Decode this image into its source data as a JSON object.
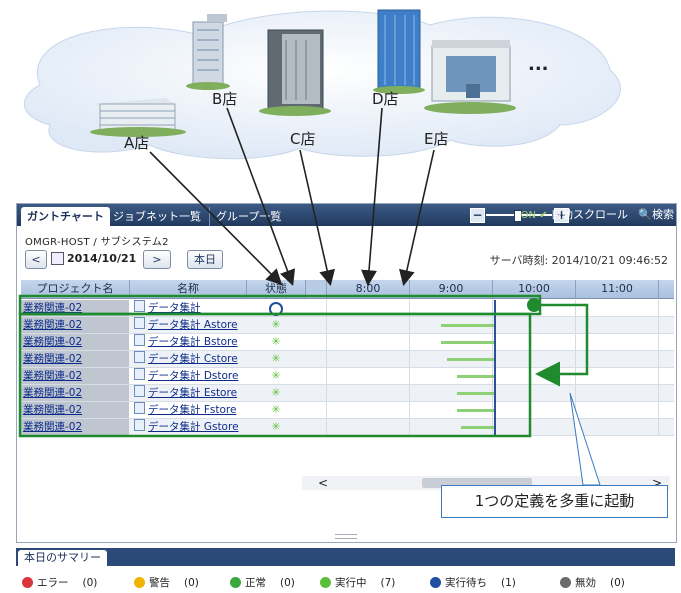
{
  "hero": {
    "stores": [
      "A店",
      "B店",
      "C店",
      "D店",
      "E店"
    ],
    "ellipsis": "..."
  },
  "app": {
    "tabs": [
      "ガントチャート",
      "ジョブネット一覧",
      "グループ一覧"
    ],
    "auto_scroll": "自動スクロール",
    "search": "検索",
    "breadcrumb": "OMGR-HOST / サブシステム2",
    "toolbar": {
      "prev": "<",
      "date": "2014/10/21",
      "next": ">",
      "today": "本日",
      "server_time": "サーバ時刻: 2014/10/21 09:46:52"
    },
    "columns": {
      "project": "プロジェクト名",
      "name": "名称",
      "status": "状態",
      "times": [
        "8:00",
        "9:00",
        "10:00",
        "11:00"
      ]
    },
    "rows": [
      {
        "project": "業務関連-02",
        "name": "データ集計",
        "status": "waiting"
      },
      {
        "project": "業務関連-02",
        "name": "データ集計 Astore",
        "status": "running"
      },
      {
        "project": "業務関連-02",
        "name": "データ集計 Bstore",
        "status": "running"
      },
      {
        "project": "業務関連-02",
        "name": "データ集計 Cstore",
        "status": "running"
      },
      {
        "project": "業務関連-02",
        "name": "データ集計 Dstore",
        "status": "running"
      },
      {
        "project": "業務関連-02",
        "name": "データ集計 Estore",
        "status": "running"
      },
      {
        "project": "業務関連-02",
        "name": "データ集計 Fstore",
        "status": "running"
      },
      {
        "project": "業務関連-02",
        "name": "データ集計 Gstore",
        "status": "running"
      }
    ],
    "scroll_left": "<",
    "scroll_right": ">"
  },
  "summary": {
    "tab": "本日のサマリー",
    "items": [
      {
        "label": "エラー",
        "count": "(0)",
        "color": "#d9343a"
      },
      {
        "label": "警告",
        "count": "(0)",
        "color": "#f0b400"
      },
      {
        "label": "正常",
        "count": "(0)",
        "color": "#3aa83c"
      },
      {
        "label": "実行中",
        "count": "(7)",
        "color": "#5cbf3a"
      },
      {
        "label": "実行待ち",
        "count": "(1)",
        "color": "#1f4ea3"
      },
      {
        "label": "無効",
        "count": "(0)",
        "color": "#6b6b6b"
      }
    ]
  },
  "callout": "1つの定義を多重に起動",
  "colors": {
    "accent_green": "#1f8a2e",
    "header_blue": "#22395e",
    "callout_border": "#3a7abf"
  }
}
